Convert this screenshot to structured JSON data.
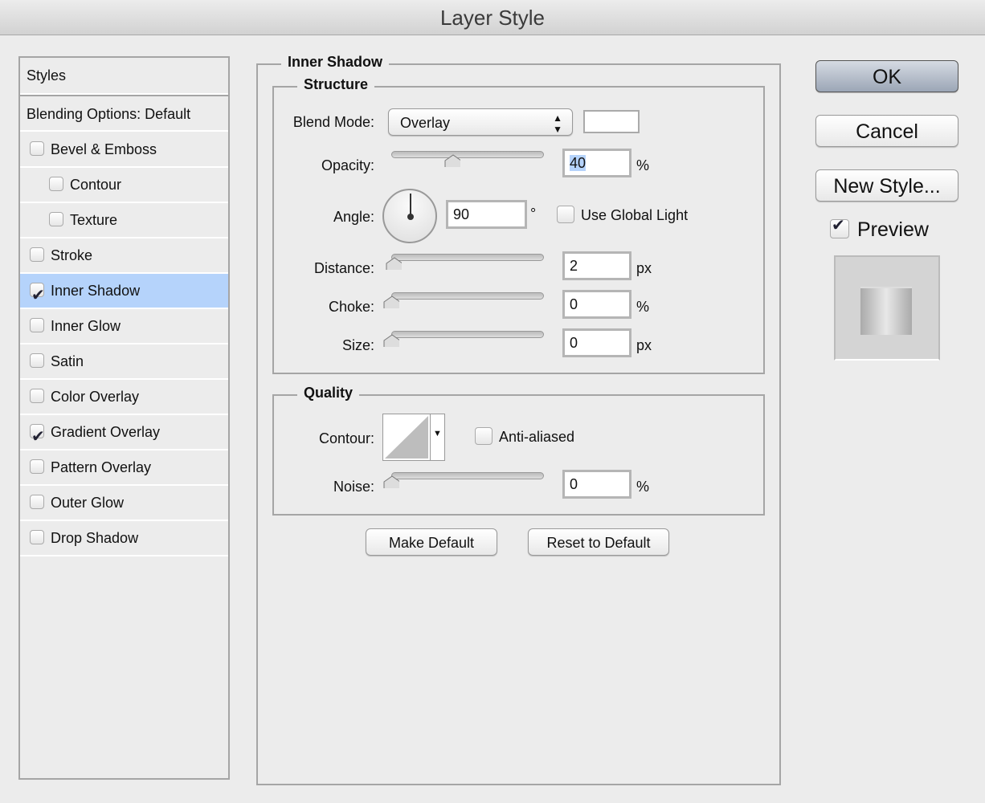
{
  "window": {
    "title": "Layer Style"
  },
  "sidebar": {
    "header": "Styles",
    "blending": "Blending Options: Default",
    "items": [
      {
        "label": "Bevel & Emboss",
        "checked": false,
        "indent": false
      },
      {
        "label": "Contour",
        "checked": false,
        "indent": true
      },
      {
        "label": "Texture",
        "checked": false,
        "indent": true
      },
      {
        "label": "Stroke",
        "checked": false,
        "indent": false
      },
      {
        "label": "Inner Shadow",
        "checked": true,
        "indent": false,
        "selected": true
      },
      {
        "label": "Inner Glow",
        "checked": false,
        "indent": false
      },
      {
        "label": "Satin",
        "checked": false,
        "indent": false
      },
      {
        "label": "Color Overlay",
        "checked": false,
        "indent": false
      },
      {
        "label": "Gradient Overlay",
        "checked": true,
        "indent": false
      },
      {
        "label": "Pattern Overlay",
        "checked": false,
        "indent": false
      },
      {
        "label": "Outer Glow",
        "checked": false,
        "indent": false
      },
      {
        "label": "Drop Shadow",
        "checked": false,
        "indent": false
      }
    ]
  },
  "panel": {
    "title": "Inner Shadow",
    "structure": {
      "title": "Structure",
      "blend_mode_label": "Blend Mode:",
      "blend_mode": "Overlay",
      "color": "#ffffff",
      "opacity_label": "Opacity:",
      "opacity": "40",
      "opacity_unit": "%",
      "angle_label": "Angle:",
      "angle": "90",
      "angle_unit": "°",
      "global_light_label": "Use Global Light",
      "global_light": false,
      "distance_label": "Distance:",
      "distance": "2",
      "distance_unit": "px",
      "choke_label": "Choke:",
      "choke": "0",
      "choke_unit": "%",
      "size_label": "Size:",
      "size": "0",
      "size_unit": "px"
    },
    "quality": {
      "title": "Quality",
      "contour_label": "Contour:",
      "anti_aliased_label": "Anti-aliased",
      "anti_aliased": false,
      "noise_label": "Noise:",
      "noise": "0",
      "noise_unit": "%"
    },
    "make_default": "Make Default",
    "reset_default": "Reset to Default"
  },
  "actions": {
    "ok": "OK",
    "cancel": "Cancel",
    "new_style": "New Style...",
    "preview_label": "Preview",
    "preview": true
  }
}
